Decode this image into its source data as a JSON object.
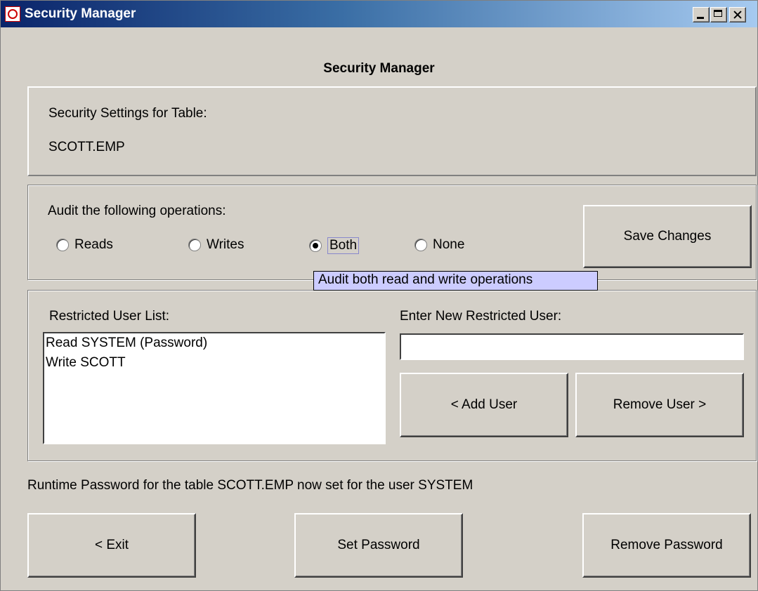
{
  "window": {
    "title": "Security Manager"
  },
  "header": {
    "title": "Security Manager"
  },
  "table_panel": {
    "label": "Security Settings for Table:",
    "table_name": "SCOTT.EMP"
  },
  "audit": {
    "label": "Audit the following operations:",
    "options": [
      {
        "label": "Reads",
        "checked": false
      },
      {
        "label": "Writes",
        "checked": false
      },
      {
        "label": "Both",
        "checked": true
      },
      {
        "label": "None",
        "checked": false
      }
    ],
    "save_label": "Save Changes",
    "tooltip": "Audit both read and write operations"
  },
  "users": {
    "list_label": "Restricted User List:",
    "items": [
      "Read SYSTEM (Password)",
      "Write SCOTT"
    ],
    "new_user_label": "Enter New Restricted User:",
    "new_user_value": "",
    "add_label": "< Add User",
    "remove_label": "Remove User >"
  },
  "status": {
    "text": "Runtime Password for the table SCOTT.EMP now set for the user SYSTEM"
  },
  "footer": {
    "exit_label": "< Exit",
    "set_password_label": "Set Password",
    "remove_password_label": "Remove Password"
  }
}
